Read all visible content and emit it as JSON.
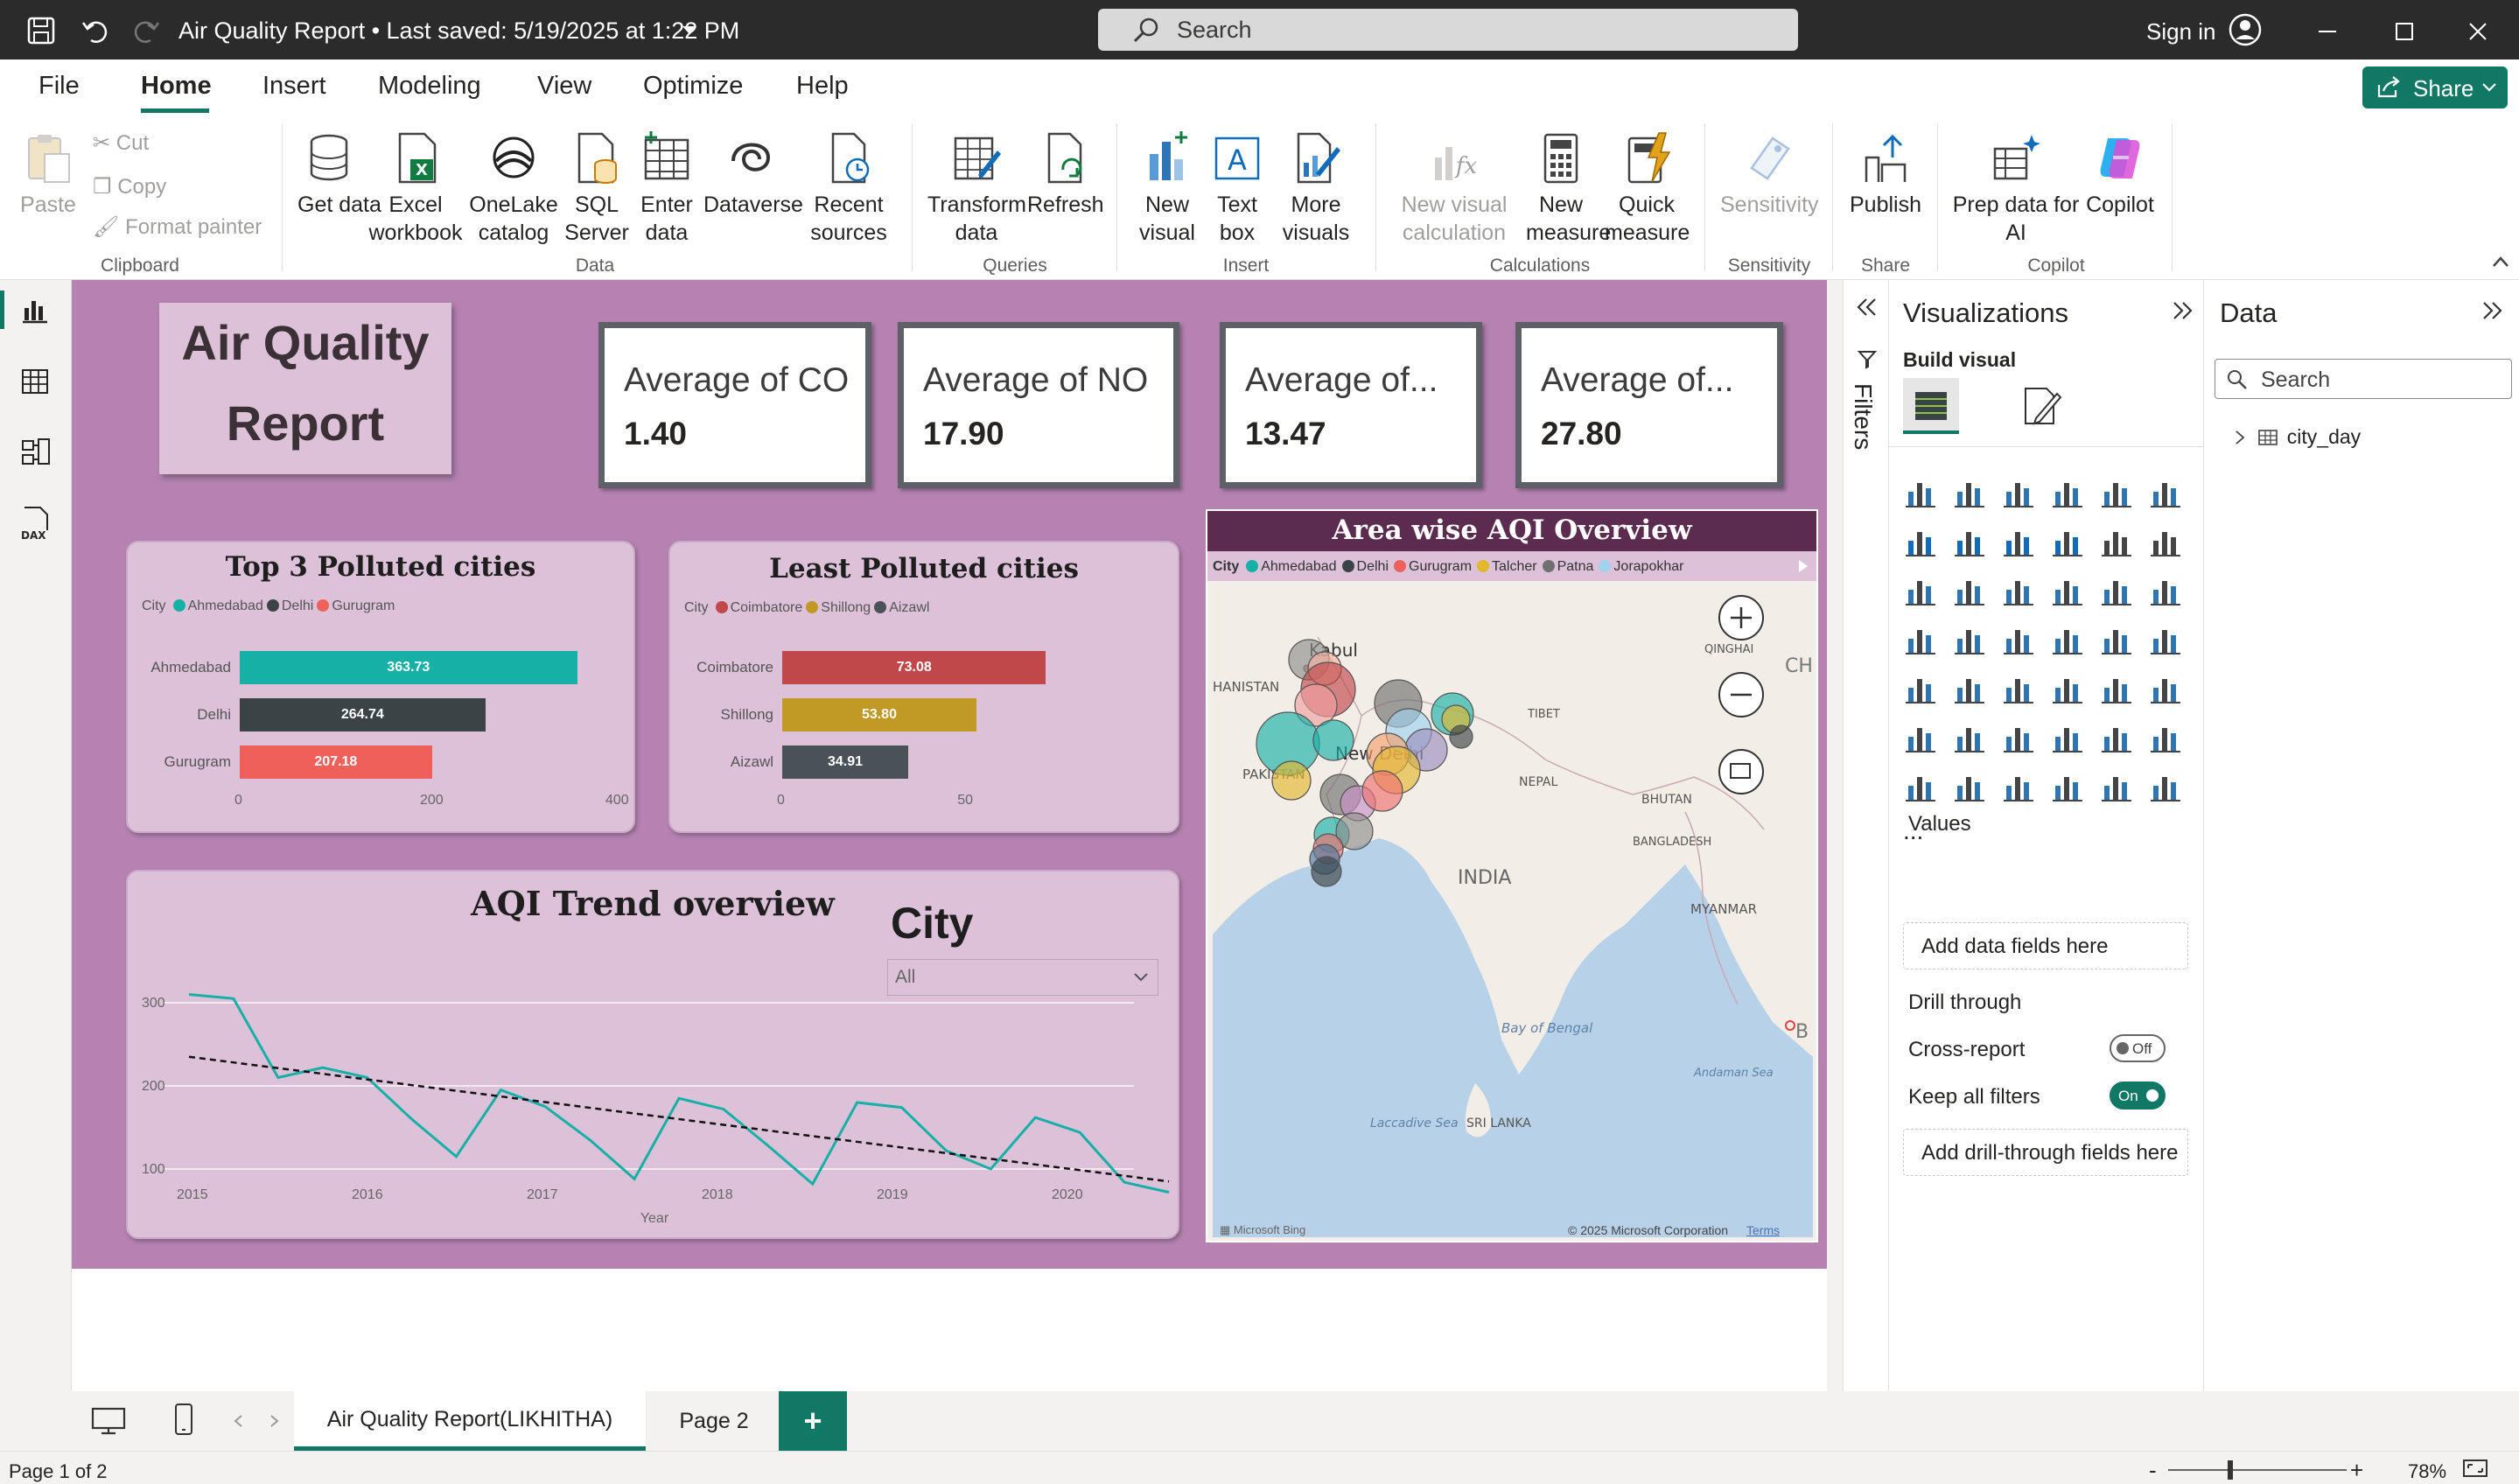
{
  "window": {
    "title": "Air Quality Report • Last saved: 5/19/2025 at 1:22 PM",
    "search_placeholder": "Search",
    "sign_in": "Sign in"
  },
  "menu": {
    "items": [
      "File",
      "Home",
      "Insert",
      "Modeling",
      "View",
      "Optimize",
      "Help"
    ],
    "active": "Home",
    "share": "Share"
  },
  "ribbon": {
    "clipboard": {
      "paste": "Paste",
      "cut": "Cut",
      "copy": "Copy",
      "format_painter": "Format painter",
      "group": "Clipboard"
    },
    "data": {
      "get_data": "Get data",
      "excel": "Excel workbook",
      "onelake": "OneLake catalog",
      "sql": "SQL Server",
      "enter": "Enter data",
      "dataverse": "Dataverse",
      "recent": "Recent sources",
      "group": "Data"
    },
    "queries": {
      "transform": "Transform data",
      "refresh": "Refresh",
      "group": "Queries"
    },
    "insert": {
      "new_visual": "New visual",
      "text_box": "Text box",
      "more_visuals": "More visuals",
      "group": "Insert"
    },
    "calculations": {
      "new_visual_calc": "New visual calculation",
      "new_measure": "New measure",
      "quick_measure": "Quick measure",
      "group": "Calculations"
    },
    "sensitivity": {
      "label": "Sensitivity",
      "group": "Sensitivity"
    },
    "share": {
      "publish": "Publish",
      "group": "Share"
    },
    "copilot": {
      "prep": "Prep data for AI",
      "copilot": "Copilot",
      "group": "Copilot"
    }
  },
  "report": {
    "title_line1": "Air Quality",
    "title_line2": "Report",
    "cards": [
      {
        "label": "Average of CO",
        "value": "1.40"
      },
      {
        "label": "Average of NO",
        "value": "17.90"
      },
      {
        "label": "Average of...",
        "value": "13.47"
      },
      {
        "label": "Average of...",
        "value": "27.80"
      }
    ],
    "top_polluted": {
      "title": "Top  3 Polluted cities",
      "legend_label": "City",
      "legend": [
        {
          "name": "Ahmedabad",
          "color": "#17b0a6"
        },
        {
          "name": "Delhi",
          "color": "#3c4347"
        },
        {
          "name": "Gurugram",
          "color": "#f0605a"
        }
      ],
      "ticks": [
        "0",
        "200",
        "400"
      ]
    },
    "least_polluted": {
      "title": "Least Polluted cities",
      "legend_label": "City",
      "legend": [
        {
          "name": "Coimbatore",
          "color": "#c0474a"
        },
        {
          "name": "Shillong",
          "color": "#c09a25"
        },
        {
          "name": "Aizawl",
          "color": "#4a5257"
        }
      ],
      "ticks": [
        "0",
        "50"
      ]
    },
    "trend": {
      "title": "AQI Trend overview",
      "xlabel": "Year",
      "slicer_title": "City",
      "slicer_value": "All"
    },
    "map": {
      "title": "Area wise AQI Overview",
      "legend_label": "City",
      "legend": [
        {
          "name": "Ahmedabad",
          "color": "#17b0a6"
        },
        {
          "name": "Delhi",
          "color": "#3c4347"
        },
        {
          "name": "Gurugram",
          "color": "#f0605a"
        },
        {
          "name": "Talcher",
          "color": "#e3b82f"
        },
        {
          "name": "Patna",
          "color": "#707070"
        },
        {
          "name": "Jorapokhar",
          "color": "#9fd3ee"
        }
      ],
      "places": [
        "Kabul",
        "HANISTAN",
        "PAKISTAN",
        "New Delhi",
        "TIBET",
        "QINGHAI",
        "NEPAL",
        "BHUTAN",
        "BANGLADESH",
        "INDIA",
        "MYANMAR",
        "Bay of Bengal",
        "Andaman Sea",
        "SRI LANKA",
        "Laccadive Sea",
        "CH",
        "B"
      ],
      "bing": "Microsoft Bing",
      "copyright": "© 2025 Microsoft Corporation",
      "terms": "Terms"
    }
  },
  "chart_data": [
    {
      "type": "bar",
      "title": "Top  3 Polluted cities",
      "categories": [
        "Ahmedabad",
        "Delhi",
        "Gurugram"
      ],
      "values": [
        363.73,
        264.74,
        207.18
      ],
      "xlim": [
        0,
        400
      ]
    },
    {
      "type": "bar",
      "title": "Least Polluted cities",
      "categories": [
        "Coimbatore",
        "Shillong",
        "Aizawl"
      ],
      "values": [
        73.08,
        53.8,
        34.91
      ],
      "xlim": [
        0,
        80
      ]
    },
    {
      "type": "line",
      "title": "AQI Trend overview",
      "xlabel": "Year",
      "x_ticks": [
        "2015",
        "2016",
        "2017",
        "2018",
        "2019",
        "2020"
      ],
      "y_ticks": [
        "100",
        "200",
        "300"
      ],
      "ylim": [
        60,
        330
      ],
      "series": [
        {
          "values": [
            310,
            305,
            210,
            222,
            210,
            160,
            115,
            195,
            175,
            135,
            88,
            185,
            172,
            128,
            82,
            180,
            174,
            122,
            100,
            162,
            144,
            84,
            72
          ]
        }
      ],
      "trend": [
        235,
        85
      ]
    }
  ],
  "filters": {
    "label": "Filters"
  },
  "visualizations": {
    "title": "Visualizations",
    "build_visual": "Build visual",
    "values": "Values",
    "add_data": "Add data fields here",
    "drill_through": "Drill through",
    "cross_report": "Cross-report",
    "cross_state": "Off",
    "keep_filters": "Keep all filters",
    "keep_state": "On",
    "add_drill": "Add drill-through fields here",
    "more": "..."
  },
  "data_pane": {
    "title": "Data",
    "search_placeholder": "Search",
    "table": "city_day"
  },
  "pages": {
    "tabs": [
      "Air Quality Report(LIKHITHA)",
      "Page 2"
    ],
    "add": "+"
  },
  "status": {
    "page": "Page 1 of 2",
    "zoom": "78%"
  }
}
